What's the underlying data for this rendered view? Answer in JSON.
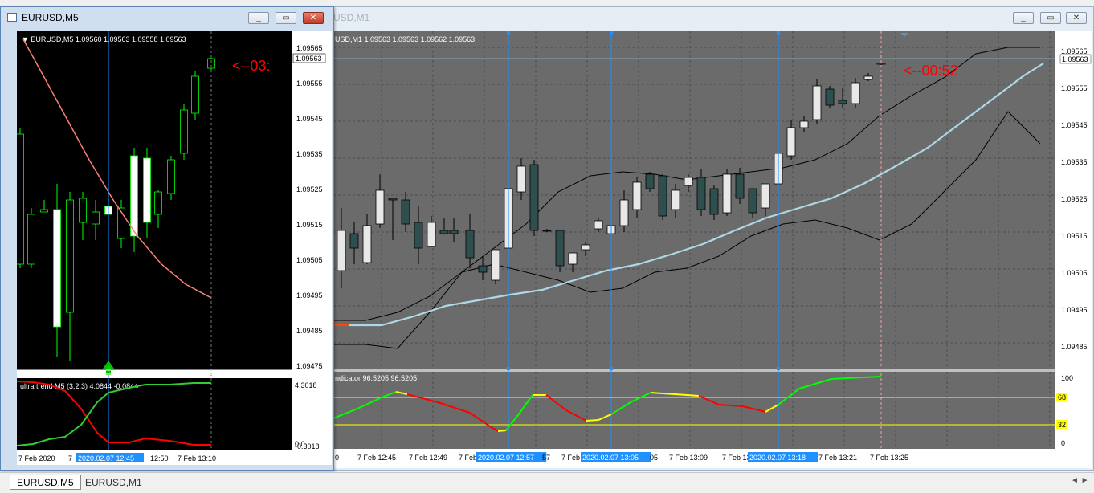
{
  "windows": {
    "background": {
      "title": "USD,M1",
      "buttons": [
        "_",
        "▭",
        "✕"
      ]
    },
    "front": {
      "title": "EURUSD,M5",
      "buttons": [
        "_",
        "▭",
        "✕"
      ]
    }
  },
  "m5": {
    "header": "▼ EURUSD,M5  1.09560 1.09563 1.09558 1.09563",
    "countdown": "<--03:",
    "current_price": "1.09563",
    "y_labels": [
      "1.09565",
      "1.09555",
      "1.09545",
      "1.09535",
      "1.09525",
      "1.09515",
      "1.09505",
      "1.09495",
      "1.09485",
      "1.09475"
    ],
    "indicator_header": "ultra trend M5 (3,2,3) 4.0844 -0.0844",
    "indicator_labels": [
      "4.3018",
      "0.0",
      "-0.3018"
    ],
    "x_labels": [
      "7 Feb 2020",
      "7",
      "2020.02.07 12:45",
      "12:50",
      "7 Feb 13:10"
    ],
    "arrow": "up"
  },
  "m1": {
    "header": "USD,M1  1.09563 1.09563 1.09562 1.09563",
    "countdown": "<--00:52",
    "current_price": "1.09563",
    "y_labels": [
      "1.09565",
      "1.09555",
      "1.09545",
      "1.09535",
      "1.09525",
      "1.09515",
      "1.09505",
      "1.09495",
      "1.09485"
    ],
    "indicator_header": "ndicator 96.5205 96.5205",
    "indicator_labels": [
      "100",
      "68",
      "32",
      "0"
    ],
    "x_labels": [
      "0",
      "7 Feb 12:45",
      "7 Feb 12:49",
      "7 Feb",
      "2020.02.07 12:57",
      "57",
      "7 Feb",
      "2020.02.07 13:05",
      "05",
      "7 Feb 13:09",
      "7 Feb 13:",
      "2020.02.07 13:18",
      "7 Feb 13:21",
      "7 Feb 13:25"
    ]
  },
  "tabs": [
    "EURUSD,M5",
    "EURUSD,M1"
  ],
  "tab_scroll": "◄ ►",
  "colors": {
    "m5_bg": "#000000",
    "m1_bg": "#6b6b6b",
    "bull": "#ffffff",
    "bear": "#2f4f4f",
    "m5_wick": "#00ff00",
    "ma_red": "#ff6347",
    "ma_light": "#add8e6",
    "vline": "#1e90ff",
    "countdown": "#ff0000",
    "osc_green": "#00ff00",
    "osc_red": "#ff0000",
    "osc_yellow": "#ffff00"
  }
}
